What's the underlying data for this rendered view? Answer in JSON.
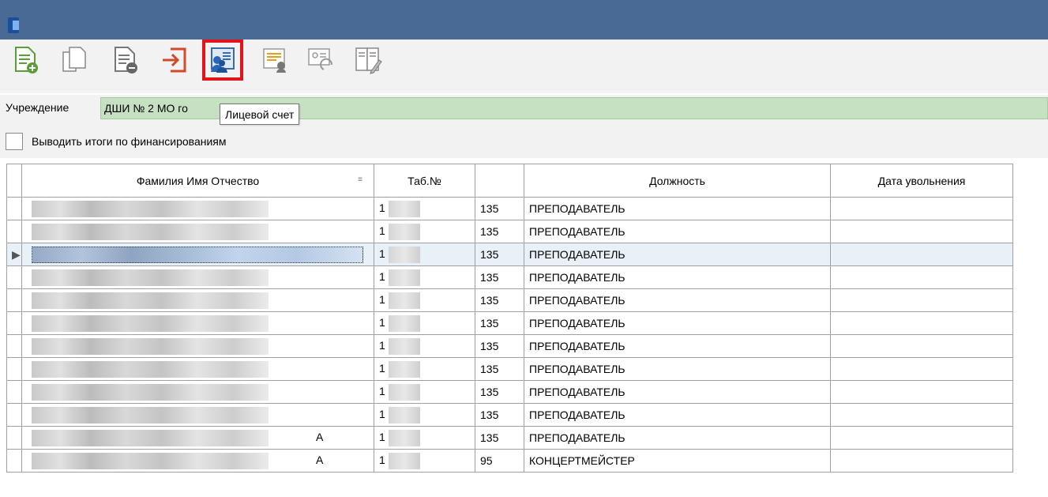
{
  "toolbar": {
    "buttons": [
      {
        "name": "add-document-icon"
      },
      {
        "name": "copy-document-icon"
      },
      {
        "name": "delete-document-icon"
      },
      {
        "name": "exit-icon"
      },
      {
        "name": "personal-account-icon"
      },
      {
        "name": "payslip-icon"
      },
      {
        "name": "card-refresh-icon"
      },
      {
        "name": "edit-document-icon"
      }
    ],
    "tooltip": "Лицевой счет"
  },
  "org": {
    "label": "Учреждение",
    "value": "ДШИ № 2 МО го"
  },
  "totals_checkbox": {
    "label": "Выводить итоги по финансированиям",
    "checked": false
  },
  "grid": {
    "headers": [
      "Фамилия Имя Отчество",
      "Таб.№",
      "",
      "Должность",
      "Дата увольнения"
    ],
    "rows": [
      {
        "name_initial": "",
        "tab_prefix": "1",
        "code": "135",
        "position": "ПРЕПОДАВАТЕЛЬ",
        "dismissal": "",
        "selected": false,
        "name_suffix": ""
      },
      {
        "name_initial": "",
        "tab_prefix": "1",
        "code": "135",
        "position": "ПРЕПОДАВАТЕЛЬ",
        "dismissal": "",
        "selected": false,
        "name_suffix": ""
      },
      {
        "name_initial": "",
        "tab_prefix": "1",
        "code": "135",
        "position": "ПРЕПОДАВАТЕЛЬ",
        "dismissal": "",
        "selected": true,
        "name_suffix": ""
      },
      {
        "name_initial": "",
        "tab_prefix": "1",
        "code": "135",
        "position": "ПРЕПОДАВАТЕЛЬ",
        "dismissal": "",
        "selected": false,
        "name_suffix": ""
      },
      {
        "name_initial": "",
        "tab_prefix": "1",
        "code": "135",
        "position": "ПРЕПОДАВАТЕЛЬ",
        "dismissal": "",
        "selected": false,
        "name_suffix": ""
      },
      {
        "name_initial": "",
        "tab_prefix": "1",
        "code": "135",
        "position": "ПРЕПОДАВАТЕЛЬ",
        "dismissal": "",
        "selected": false,
        "name_suffix": ""
      },
      {
        "name_initial": "",
        "tab_prefix": "1",
        "code": "135",
        "position": "ПРЕПОДАВАТЕЛЬ",
        "dismissal": "",
        "selected": false,
        "name_suffix": ""
      },
      {
        "name_initial": "",
        "tab_prefix": "1",
        "code": "135",
        "position": "ПРЕПОДАВАТЕЛЬ",
        "dismissal": "",
        "selected": false,
        "name_suffix": ""
      },
      {
        "name_initial": "",
        "tab_prefix": "1",
        "code": "135",
        "position": "ПРЕПОДАВАТЕЛЬ",
        "dismissal": "",
        "selected": false,
        "name_suffix": ""
      },
      {
        "name_initial": "",
        "tab_prefix": "1",
        "code": "135",
        "position": "ПРЕПОДАВАТЕЛЬ",
        "dismissal": "",
        "selected": false,
        "name_suffix": ""
      },
      {
        "name_initial": "",
        "tab_prefix": "1",
        "code": "135",
        "position": "ПРЕПОДАВАТЕЛЬ",
        "dismissal": "",
        "selected": false,
        "name_suffix": "А"
      },
      {
        "name_initial": "",
        "tab_prefix": "1",
        "code": "95",
        "position": "КОНЦЕРТМЕЙСТЕР",
        "dismissal": "",
        "selected": false,
        "name_suffix": "А"
      }
    ]
  },
  "colors": {
    "titlebar": "#4a6a96",
    "org_field": "#c6e0c2",
    "active_highlight": "#e0141a",
    "selected_row": "#e8f0f8"
  }
}
